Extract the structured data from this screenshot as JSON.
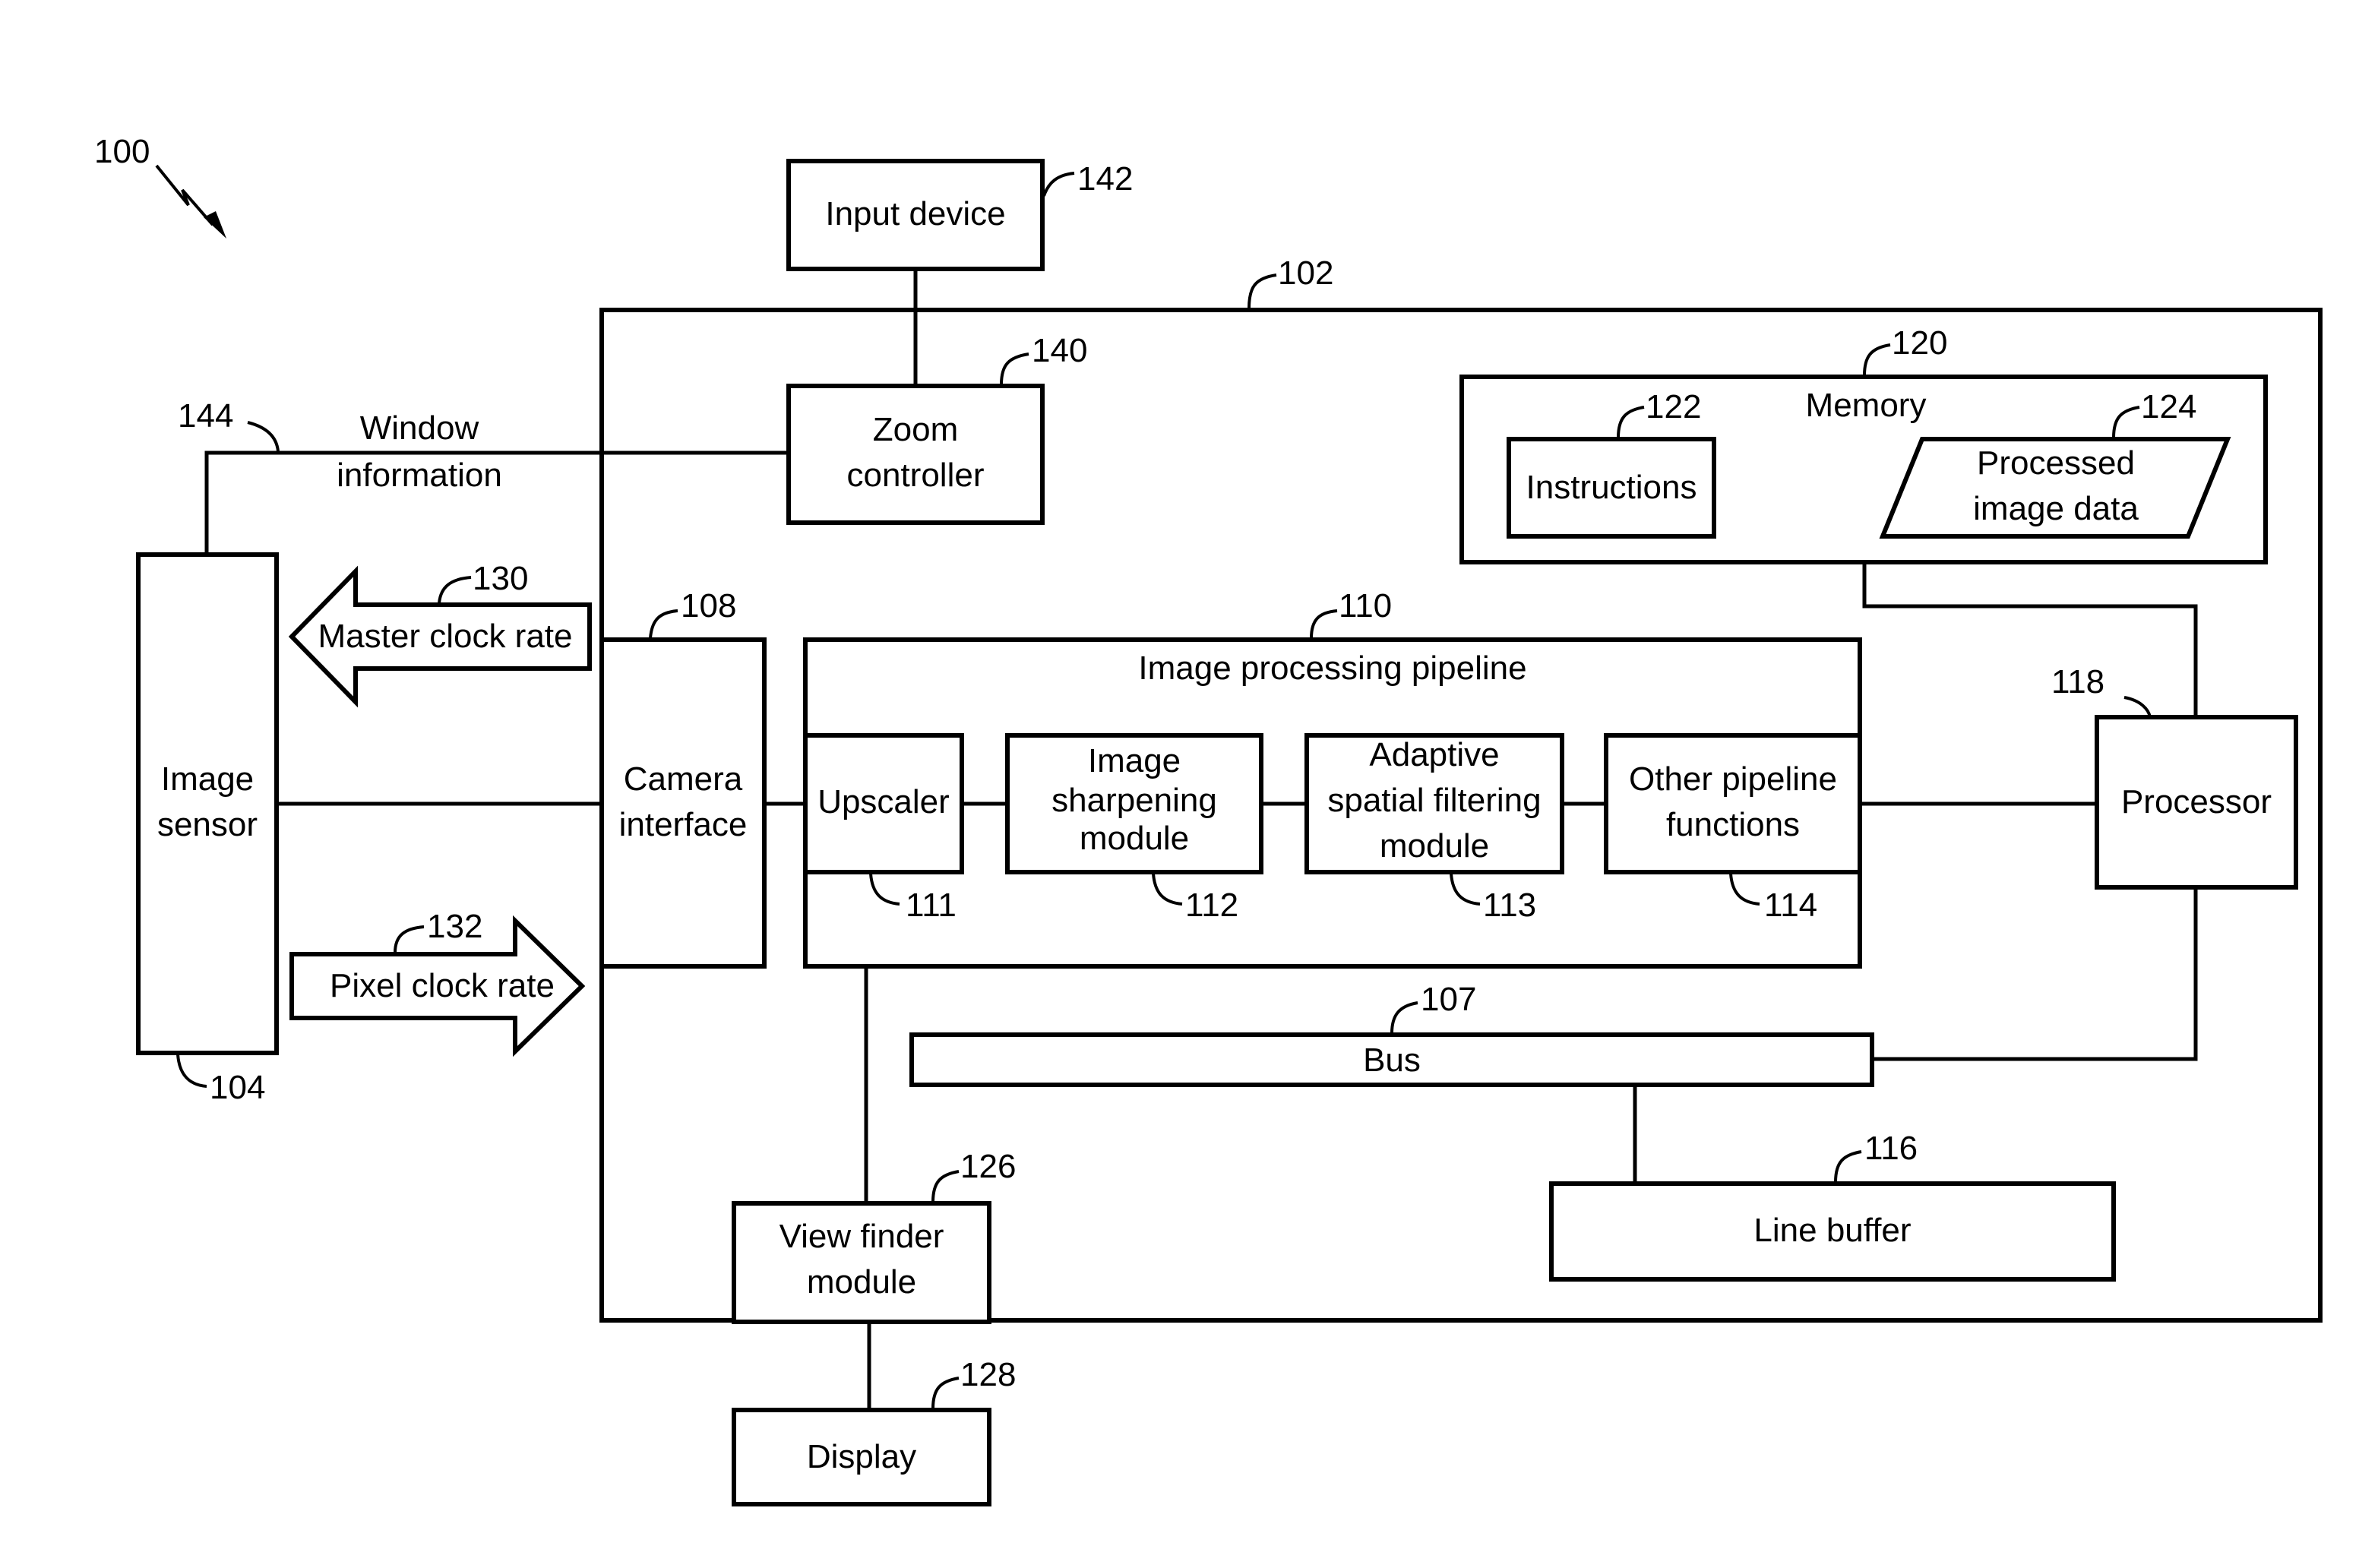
{
  "figure": {
    "ref": "100",
    "blocks": {
      "input_device": {
        "label": [
          "Input device"
        ],
        "ref": "142"
      },
      "system": {
        "ref": "102"
      },
      "zoom_controller": {
        "label": [
          "Zoom",
          "controller"
        ],
        "ref": "140"
      },
      "memory": {
        "label": "Memory",
        "ref": "120"
      },
      "instructions": {
        "label": [
          "Instructions"
        ],
        "ref": "122"
      },
      "processed_image_data": {
        "label": [
          "Processed",
          "image data"
        ],
        "ref": "124"
      },
      "image_sensor": {
        "label": [
          "Image",
          "sensor"
        ],
        "ref": "104"
      },
      "camera_interface": {
        "label": [
          "Camera",
          "interface"
        ],
        "ref": "108"
      },
      "pipeline": {
        "label": "Image processing pipeline",
        "ref": "110"
      },
      "upscaler": {
        "label": [
          "Upscaler"
        ],
        "ref": "111"
      },
      "sharpening": {
        "label": [
          "Image",
          "sharpening",
          "module"
        ],
        "ref": "112"
      },
      "adaptive_filter": {
        "label": [
          "Adaptive",
          "spatial filtering",
          "module"
        ],
        "ref": "113"
      },
      "other_functions": {
        "label": [
          "Other pipeline",
          "functions"
        ],
        "ref": "114"
      },
      "processor": {
        "label": [
          "Processor"
        ],
        "ref": "118"
      },
      "bus": {
        "label": [
          "Bus"
        ],
        "ref": "107"
      },
      "line_buffer": {
        "label": [
          "Line buffer"
        ],
        "ref": "116"
      },
      "view_finder": {
        "label": [
          "View finder",
          "module"
        ],
        "ref": "126"
      },
      "display": {
        "label": [
          "Display"
        ],
        "ref": "128"
      }
    },
    "signals": {
      "window_info": {
        "label": [
          "Window",
          "information"
        ],
        "ref": "144"
      },
      "master_clock": {
        "label": "Master clock rate",
        "ref": "130"
      },
      "pixel_clock": {
        "label": "Pixel clock rate",
        "ref": "132"
      }
    }
  }
}
